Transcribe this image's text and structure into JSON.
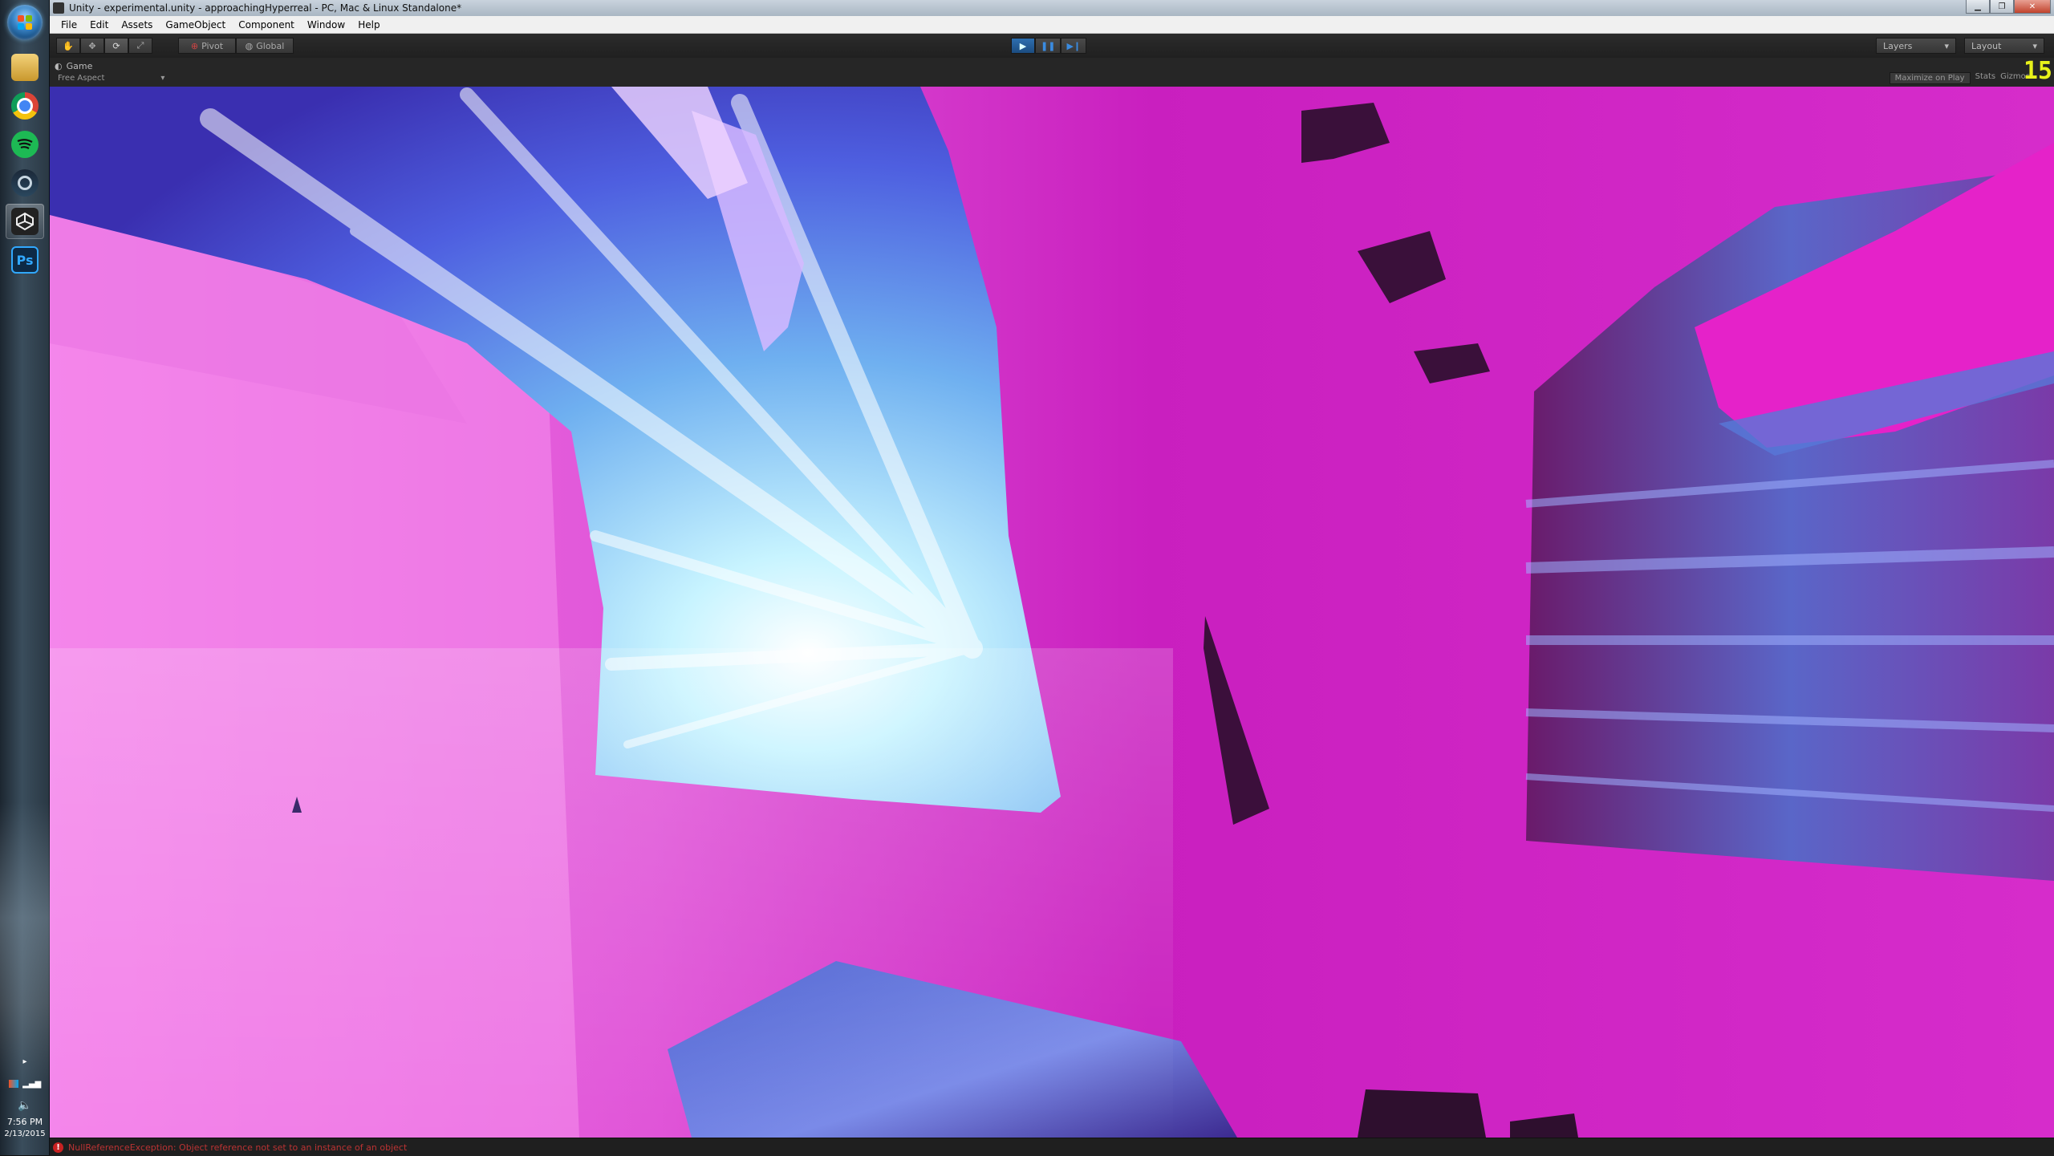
{
  "window": {
    "title": "Unity - experimental.unity - approachingHyperreal - PC, Mac & Linux Standalone*",
    "controls": [
      "minimize",
      "maximize",
      "close"
    ]
  },
  "menu": [
    "File",
    "Edit",
    "Assets",
    "GameObject",
    "Component",
    "Window",
    "Help"
  ],
  "toolbar": {
    "transform_tools": [
      "hand-icon",
      "move-icon",
      "rotate-icon",
      "scale-icon"
    ],
    "pivot_label": "Pivot",
    "global_label": "Global",
    "play_controls": [
      "play-icon",
      "pause-icon",
      "step-icon"
    ],
    "layers_label": "Layers",
    "layout_label": "Layout"
  },
  "game_view": {
    "tab_label": "Game",
    "aspect_label": "Free Aspect",
    "maximize_on_play": "Maximize on Play",
    "stats_label": "Stats",
    "gizmos_label": "Gizmos",
    "fps_counter": "15"
  },
  "status": {
    "message": "NullReferenceException: Object reference not set to an instance of an object"
  },
  "taskbar": {
    "apps": [
      "explorer-icon",
      "chrome-icon",
      "spotify-icon",
      "steam-icon",
      "unity-icon",
      "photoshop-icon"
    ],
    "photoshop_label": "Ps",
    "time": "7:56 PM",
    "date": "2/13/2015"
  },
  "colors": {
    "scene_magenta": "#cc22c4",
    "scene_pink": "#f070e8",
    "scene_blue": "#5a78e0",
    "fps_yellow": "#e8f21a",
    "error_red": "#c92222"
  }
}
